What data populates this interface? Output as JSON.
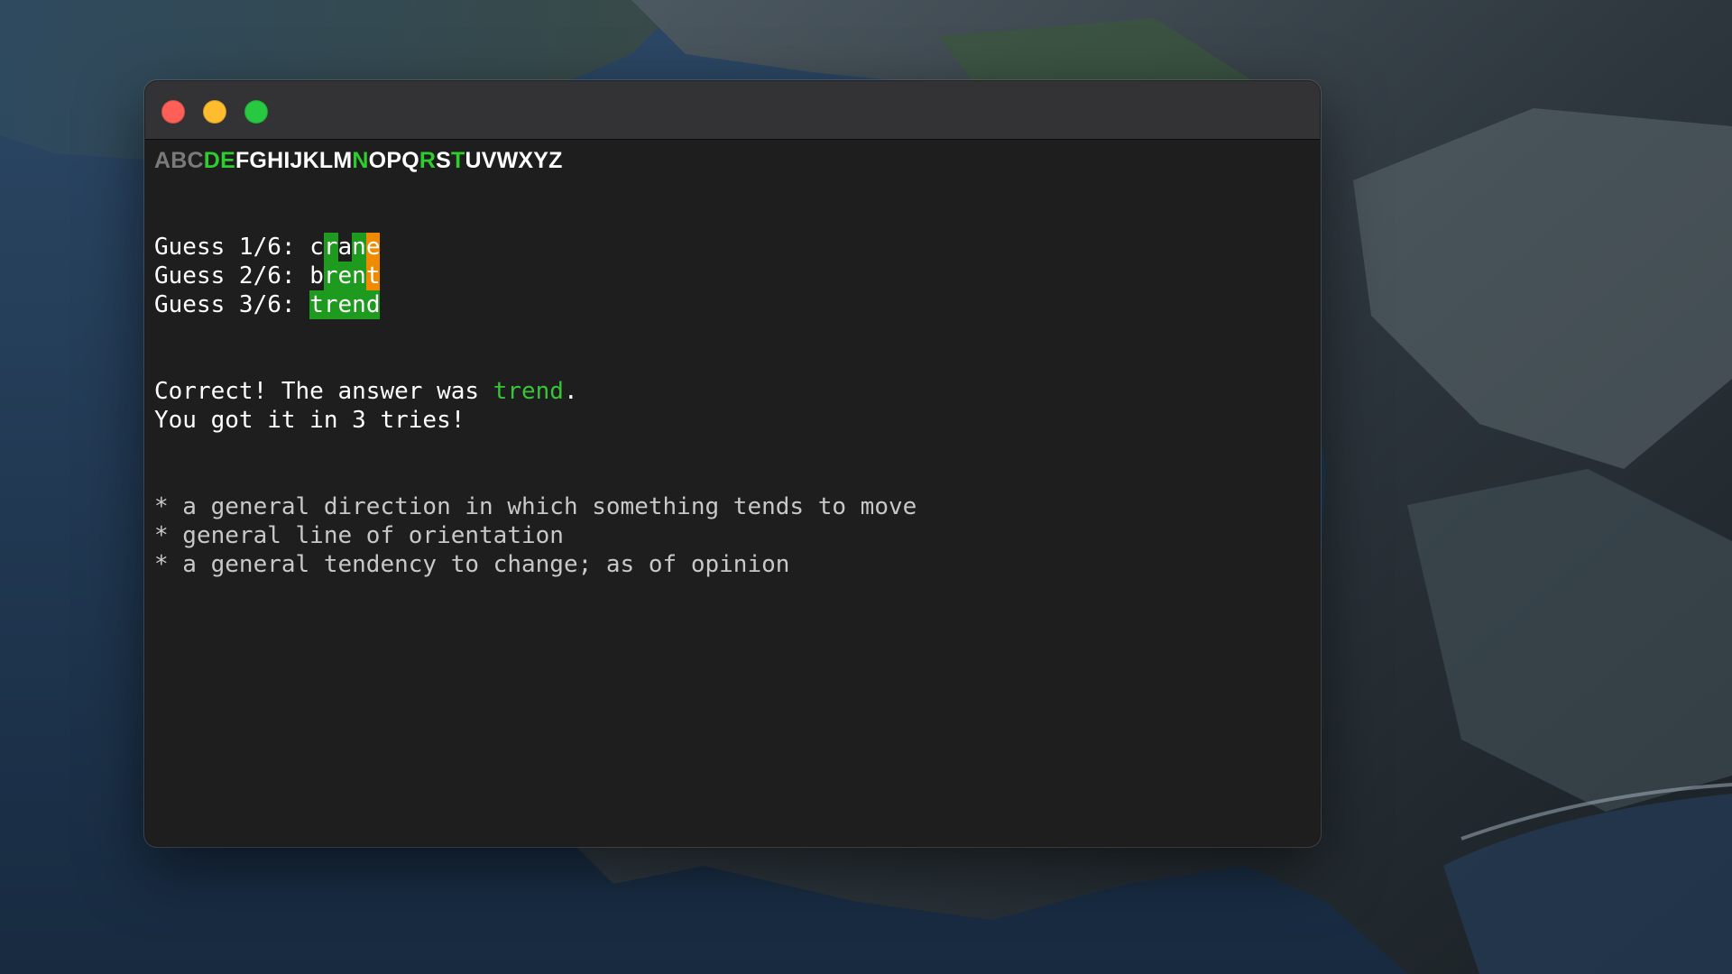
{
  "colors": {
    "correct": "#1e9a1e",
    "present": "#f08a00",
    "absent": "transparent",
    "alpha_used_correct": "#2ecc2e",
    "alpha_used_absent": "#7a7a7a",
    "alpha_unused": "#ffffff",
    "answer_highlight": "#38c438",
    "close_light": "#ff5f57",
    "minimize_light": "#febc2e",
    "zoom_light": "#28c840"
  },
  "window": {
    "controls": [
      {
        "name": "close-button",
        "icon": "close-dot-icon",
        "color": "#ff5f57"
      },
      {
        "name": "minimize-button",
        "icon": "minimize-dot-icon",
        "color": "#febc2e"
      },
      {
        "name": "zoom-button",
        "icon": "zoom-dot-icon",
        "color": "#28c840"
      }
    ]
  },
  "terminal": {
    "alphabet": [
      {
        "letter": "A",
        "state": "absent"
      },
      {
        "letter": "B",
        "state": "absent"
      },
      {
        "letter": "C",
        "state": "absent"
      },
      {
        "letter": "D",
        "state": "correct"
      },
      {
        "letter": "E",
        "state": "correct"
      },
      {
        "letter": "F",
        "state": "unused"
      },
      {
        "letter": "G",
        "state": "unused"
      },
      {
        "letter": "H",
        "state": "unused"
      },
      {
        "letter": "I",
        "state": "unused"
      },
      {
        "letter": "J",
        "state": "unused"
      },
      {
        "letter": "K",
        "state": "unused"
      },
      {
        "letter": "L",
        "state": "unused"
      },
      {
        "letter": "M",
        "state": "unused"
      },
      {
        "letter": "N",
        "state": "correct"
      },
      {
        "letter": "O",
        "state": "unused"
      },
      {
        "letter": "P",
        "state": "unused"
      },
      {
        "letter": "Q",
        "state": "unused"
      },
      {
        "letter": "R",
        "state": "correct"
      },
      {
        "letter": "S",
        "state": "unused"
      },
      {
        "letter": "T",
        "state": "correct"
      },
      {
        "letter": "U",
        "state": "unused"
      },
      {
        "letter": "V",
        "state": "unused"
      },
      {
        "letter": "W",
        "state": "unused"
      },
      {
        "letter": "X",
        "state": "unused"
      },
      {
        "letter": "Y",
        "state": "unused"
      },
      {
        "letter": "Z",
        "state": "unused"
      }
    ],
    "guesses": [
      {
        "label": "Guess 1/6: ",
        "letters": [
          {
            "ch": "c",
            "state": "absent"
          },
          {
            "ch": "r",
            "state": "correct"
          },
          {
            "ch": "a",
            "state": "absent"
          },
          {
            "ch": "n",
            "state": "correct"
          },
          {
            "ch": "e",
            "state": "present"
          }
        ]
      },
      {
        "label": "Guess 2/6: ",
        "letters": [
          {
            "ch": "b",
            "state": "absent"
          },
          {
            "ch": "r",
            "state": "correct"
          },
          {
            "ch": "e",
            "state": "correct"
          },
          {
            "ch": "n",
            "state": "correct"
          },
          {
            "ch": "t",
            "state": "present"
          }
        ]
      },
      {
        "label": "Guess 3/6: ",
        "letters": [
          {
            "ch": "t",
            "state": "correct"
          },
          {
            "ch": "r",
            "state": "correct"
          },
          {
            "ch": "e",
            "state": "correct"
          },
          {
            "ch": "n",
            "state": "correct"
          },
          {
            "ch": "d",
            "state": "correct"
          }
        ]
      }
    ],
    "result": {
      "prefix": "Correct! The answer was ",
      "answer": "trend",
      "suffix": ".",
      "tries_line": "You got it in 3 tries!"
    },
    "definitions": [
      "* a general direction in which something tends to move",
      "* general line of orientation",
      "* a general tendency to change; as of opinion"
    ]
  }
}
